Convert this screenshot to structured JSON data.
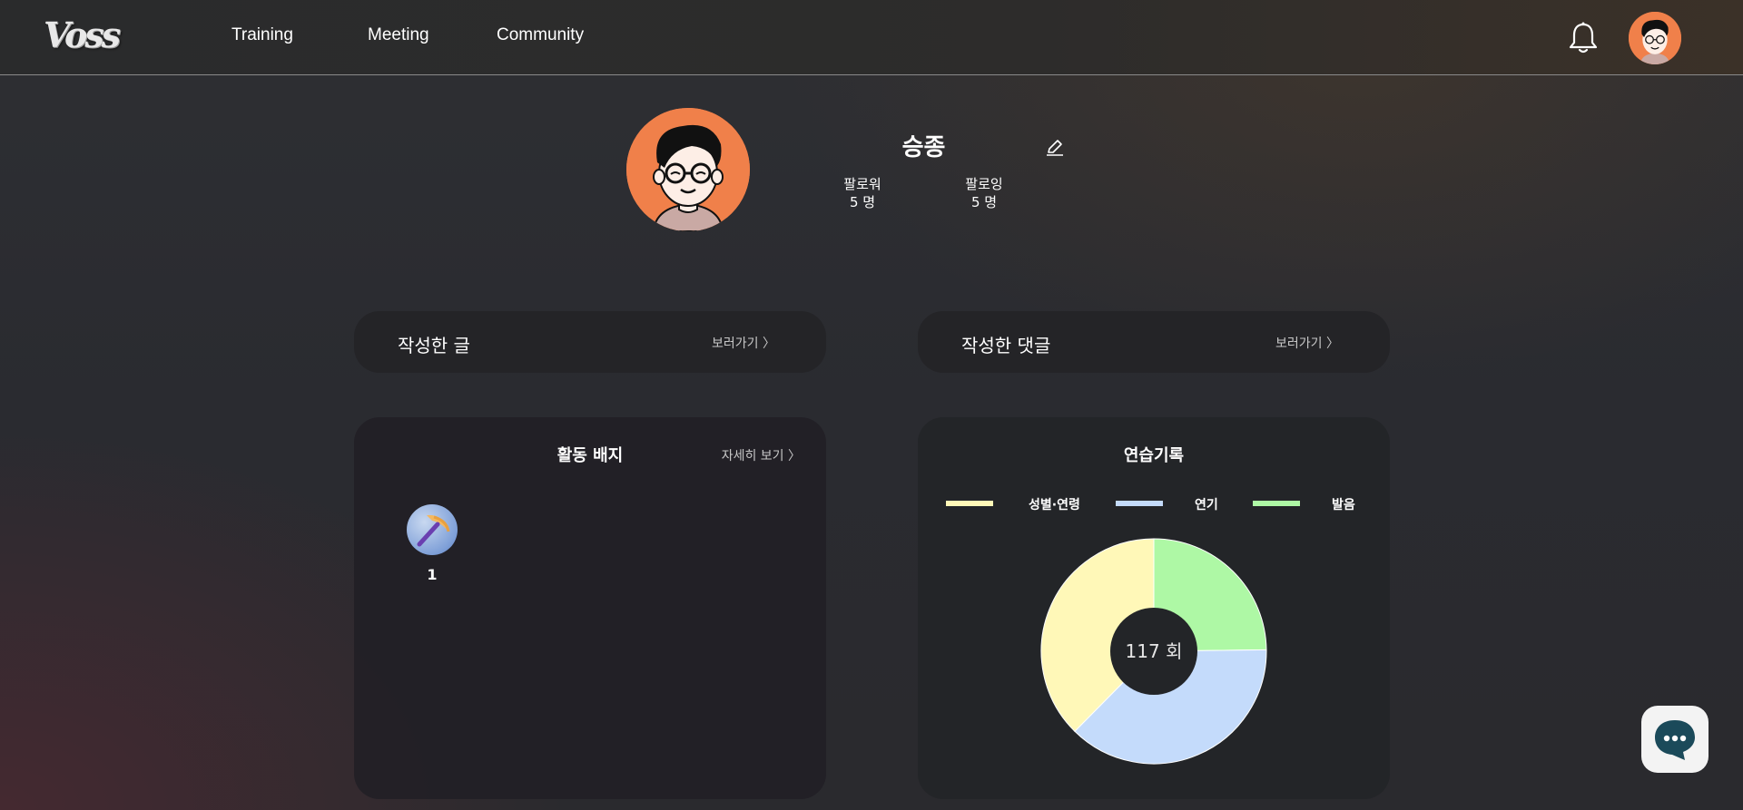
{
  "header": {
    "logo_text": "Voss",
    "nav": [
      {
        "label": "Training"
      },
      {
        "label": "Meeting"
      },
      {
        "label": "Community"
      }
    ]
  },
  "profile": {
    "name": "승종",
    "followers_label": "팔로워",
    "followers_value": "5 명",
    "following_label": "팔로잉",
    "following_value": "5 명"
  },
  "posts_card": {
    "title": "작성한 글",
    "link": "보러가기 〉"
  },
  "comments_card": {
    "title": "작성한 댓글",
    "link": "보러가기 〉"
  },
  "badges": {
    "title": "활동 배지",
    "link": "자세히 보기 〉",
    "items": [
      {
        "icon": "pickaxe-badge-icon",
        "count": "1"
      }
    ]
  },
  "practice": {
    "title": "연습기록",
    "total_label": "117 회",
    "legend": [
      {
        "label": "성별·연령",
        "color": "#fff8b8"
      },
      {
        "label": "연기",
        "color": "#c4dbfb"
      },
      {
        "label": "발음",
        "color": "#aef8a5"
      }
    ]
  },
  "chart_data": {
    "type": "pie",
    "title": "연습기록",
    "series": [
      {
        "name": "발음",
        "value": 29,
        "color": "#aef8a5"
      },
      {
        "name": "연기",
        "value": 44,
        "color": "#c4dbfb"
      },
      {
        "name": "성별·연령",
        "value": 44,
        "color": "#fff8b8"
      }
    ],
    "center_label": "117 회",
    "legend_position": "top"
  }
}
